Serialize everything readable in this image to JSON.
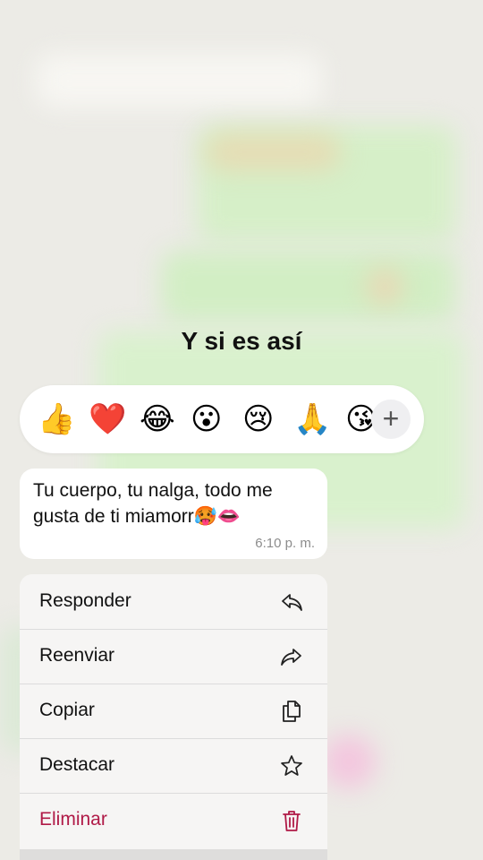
{
  "title": "Y si es así",
  "reactions": {
    "emojis": [
      "👍",
      "❤️",
      "😂",
      "😮",
      "😢",
      "🙏",
      "😘"
    ],
    "more_label": "+"
  },
  "message": {
    "text": "Tu cuerpo, tu nalga, todo me gusta de ti miamorr🥵👄",
    "time": "6:10 p. m."
  },
  "menu": {
    "items": [
      {
        "label": "Responder",
        "icon": "reply-icon"
      },
      {
        "label": "Reenviar",
        "icon": "forward-icon"
      },
      {
        "label": "Copiar",
        "icon": "copy-icon"
      },
      {
        "label": "Destacar",
        "icon": "star-icon"
      },
      {
        "label": "Eliminar",
        "icon": "trash-icon"
      }
    ],
    "danger_color": "#b01a47"
  }
}
